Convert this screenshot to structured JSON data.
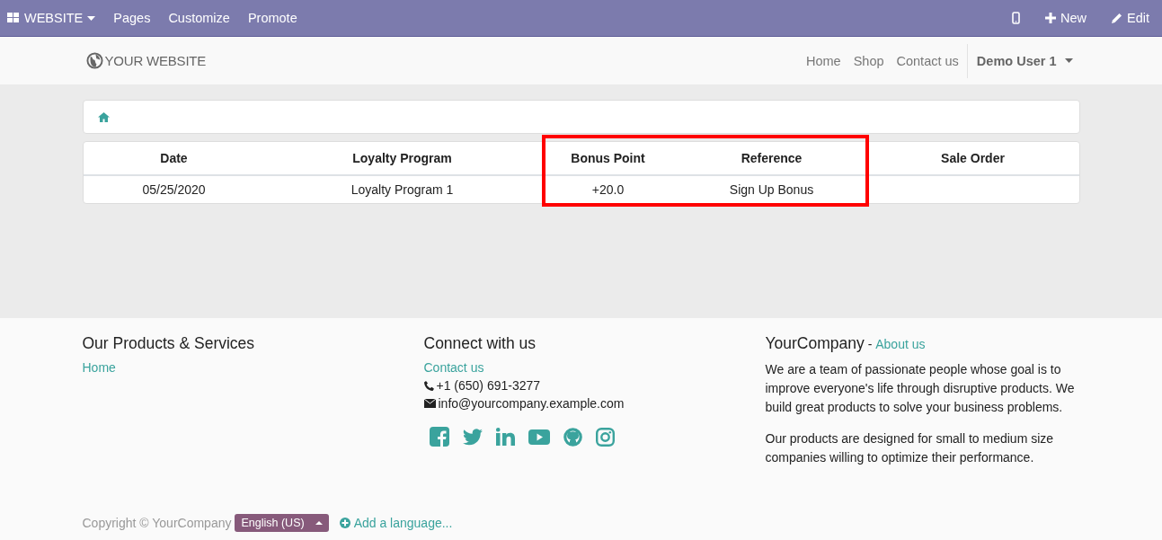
{
  "admin_bar": {
    "app_menu": "WEBSITE",
    "menu": [
      "Pages",
      "Customize",
      "Promote"
    ],
    "new_button": "New",
    "edit_button": "Edit"
  },
  "header": {
    "logo": "YOUR WEBSITE",
    "nav": [
      "Home",
      "Shop",
      "Contact us"
    ],
    "user": "Demo User 1"
  },
  "table": {
    "columns": [
      {
        "label": "Date",
        "highlighted": false
      },
      {
        "label": "Loyalty Program",
        "highlighted": false
      },
      {
        "label": "Bonus Point",
        "highlighted": true
      },
      {
        "label": "Reference",
        "highlighted": true
      },
      {
        "label": "Sale Order",
        "highlighted": false
      }
    ],
    "rows": [
      [
        "05/25/2020",
        "Loyalty Program 1",
        "+20.0",
        "Sign Up Bonus",
        ""
      ]
    ]
  },
  "footer": {
    "col1": {
      "title": "Our Products & Services",
      "links": [
        "Home"
      ]
    },
    "col2": {
      "title": "Connect with us",
      "link": "Contact us",
      "phone": "+1 (650) 691-3277",
      "email": "info@yourcompany.example.com"
    },
    "col3": {
      "title": "YourCompany",
      "title_suffix": " - ",
      "link": "About us",
      "paragraphs": [
        "We are a team of passionate people whose goal is to improve everyone's life through disruptive products. We build great products to solve your business problems.",
        "Our products are designed for small to medium size companies willing to optimize their performance."
      ]
    },
    "copyright": "Copyright © YourCompany",
    "language": "English (US)",
    "add_language": "Add a language..."
  }
}
